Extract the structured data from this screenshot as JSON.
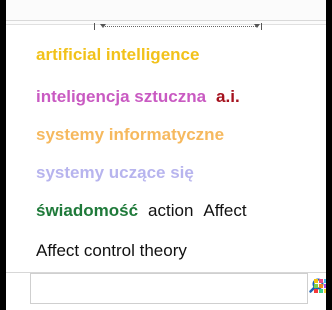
{
  "tags": [
    [
      {
        "text": "artificial intelligence",
        "color": "#f2c21a",
        "bold": true
      }
    ],
    [
      {
        "text": "inteligencja sztuczna",
        "color": "#c95ac2",
        "bold": true
      },
      {
        "text": "a.i.",
        "color": "#a5121e",
        "bold": true
      }
    ],
    [
      {
        "text": "systemy informatyczne",
        "color": "#f6b95e",
        "bold": true
      }
    ],
    [
      {
        "text": "systemy uczące się",
        "color": "#b7b4ee",
        "bold": true
      }
    ],
    [
      {
        "text": "świadomość",
        "color": "#1f7a3a",
        "bold": true
      },
      {
        "text": "action",
        "color": "#111111",
        "bold": false
      },
      {
        "text": "Affect",
        "color": "#111111",
        "bold": false
      }
    ],
    [
      {
        "text": "Affect control theory",
        "color": "#111111",
        "bold": false
      }
    ]
  ],
  "search": {
    "placeholder": "",
    "value": "",
    "button_icon": "search-icon",
    "view_icon": "grid-view-icon"
  },
  "grid_colors": [
    "#f4c30f",
    "#ea4c89",
    "#49b9e8",
    "#7fd24a",
    "#f48a1c",
    "#b44ce0",
    "#f43a3a",
    "#3ad18e",
    "#f6d33a"
  ]
}
